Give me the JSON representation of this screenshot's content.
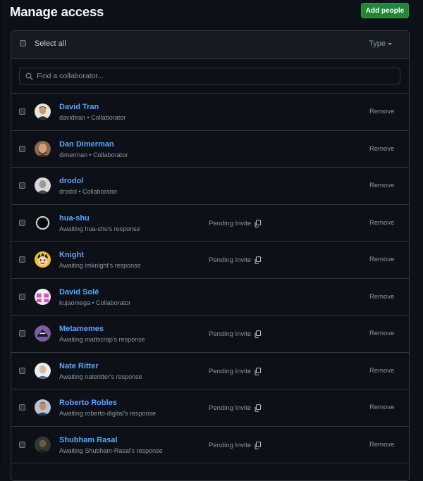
{
  "header": {
    "title": "Manage access",
    "add_button": "Add people"
  },
  "toolbar": {
    "select_all": "Select all",
    "type_filter": "Type"
  },
  "search": {
    "placeholder": "Find a collaborator..."
  },
  "members": [
    {
      "name": "David Tran",
      "subtitle": "davidtran • Collaborator",
      "pending": "",
      "action": "Remove",
      "avatar": "photo-asian-man"
    },
    {
      "name": "Dan Dimerman",
      "subtitle": "dimerman • Collaborator",
      "pending": "",
      "action": "Remove",
      "avatar": "photo-bald-man"
    },
    {
      "name": "drodol",
      "subtitle": "drodol • Collaborator",
      "pending": "",
      "action": "Remove",
      "avatar": "photo-grayscale"
    },
    {
      "name": "hua-shu",
      "subtitle": "Awaiting hua-shu's response",
      "pending": "Pending Invite",
      "action": "Remove",
      "avatar": "dark-ring"
    },
    {
      "name": "Knight",
      "subtitle": "Awaiting imknight's response",
      "pending": "Pending Invite",
      "action": "Remove",
      "avatar": "cartoon-face"
    },
    {
      "name": "David Solé",
      "subtitle": "kujaomega • Collaborator",
      "pending": "",
      "action": "Remove",
      "avatar": "pink-identicon"
    },
    {
      "name": "Metamemes",
      "subtitle": "Awaiting mattscrap's response",
      "pending": "Pending Invite",
      "action": "Remove",
      "avatar": "purple-hat"
    },
    {
      "name": "Nate Ritter",
      "subtitle": "Awaiting nateritter's response",
      "pending": "Pending Invite",
      "action": "Remove",
      "avatar": "photo-man-light"
    },
    {
      "name": "Roberto Robles",
      "subtitle": "Awaiting roberto-digital's response",
      "pending": "Pending Invite",
      "action": "Remove",
      "avatar": "photo-man-dark"
    },
    {
      "name": "Shubham Rasal",
      "subtitle": "Awaiting Shubham-Rasal's response",
      "pending": "Pending Invite",
      "action": "Remove",
      "avatar": "photo-dark-green"
    }
  ],
  "colors": {
    "background": "#0d1117",
    "header_bg": "#161b22",
    "border": "#30363d",
    "link": "#58a6ff",
    "muted": "#8b949e",
    "primary_button": "#238636"
  }
}
